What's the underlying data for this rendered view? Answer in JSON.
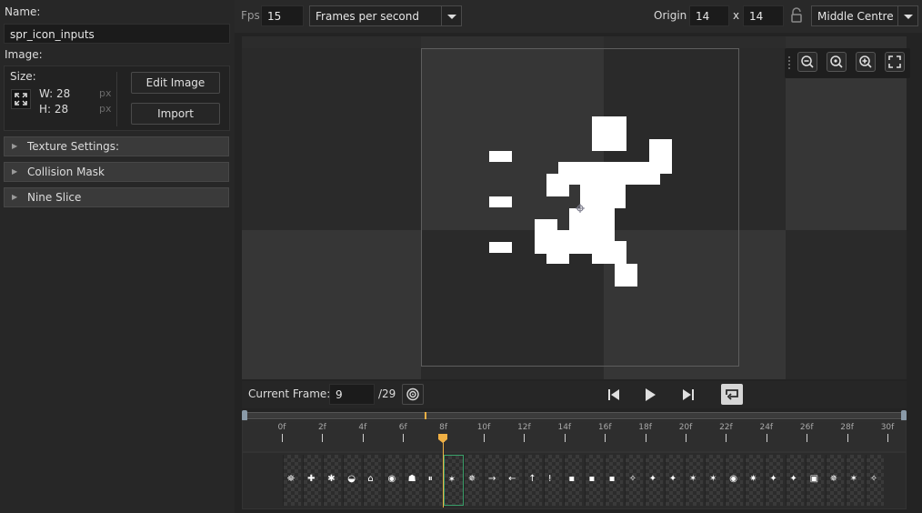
{
  "left_panel": {
    "name_label": "Name:",
    "name_value": "spr_icon_inputs",
    "image_label": "Image:",
    "size_label": "Size:",
    "width_label": "W: 28",
    "height_label": "H: 28",
    "px_unit": "px",
    "edit_image_label": "Edit Image",
    "import_label": "Import",
    "sections": [
      "Texture Settings:",
      "Collision Mask",
      "Nine Slice"
    ]
  },
  "topbar": {
    "fps_label": "Fps",
    "fps_value": "15",
    "speed_mode": "Frames per second",
    "origin_label": "Origin",
    "origin_x": "14",
    "origin_sep": "x",
    "origin_y": "14",
    "origin_preset": "Middle Centre"
  },
  "zoom_toolbar": {
    "icons": [
      "zoom-out-icon",
      "zoom-reset-icon",
      "zoom-in-icon",
      "fit-screen-icon"
    ]
  },
  "playback": {
    "current_frame_label": "Current Frame:",
    "current_frame_value": "9",
    "total_frames": "/29"
  },
  "timeline": {
    "ticks": [
      "0f",
      "2f",
      "4f",
      "6f",
      "8f",
      "10f",
      "12f",
      "14f",
      "16f",
      "18f",
      "20f",
      "22f",
      "24f",
      "26f",
      "28f",
      "30f"
    ],
    "playhead_frame": 8,
    "selected_frame_index": 8,
    "frame_count": 30,
    "frame_glyphs": [
      "⛯",
      "✚",
      "✱",
      "◒",
      "⌂",
      "◉",
      "☗",
      "⏸",
      "✶",
      "✵",
      "→",
      "←",
      "↑",
      "ǃ",
      "▪",
      "▪",
      "▪",
      "✧",
      "✦",
      "✦",
      "✶",
      "✶",
      "◉",
      "✷",
      "✦",
      "✦",
      "▣",
      "✵",
      "✶",
      "✧"
    ]
  },
  "colors": {
    "accent_playhead": "#f0b044",
    "selected_frame_border": "#3aa06a",
    "loop_button": "#d6d6d6"
  }
}
